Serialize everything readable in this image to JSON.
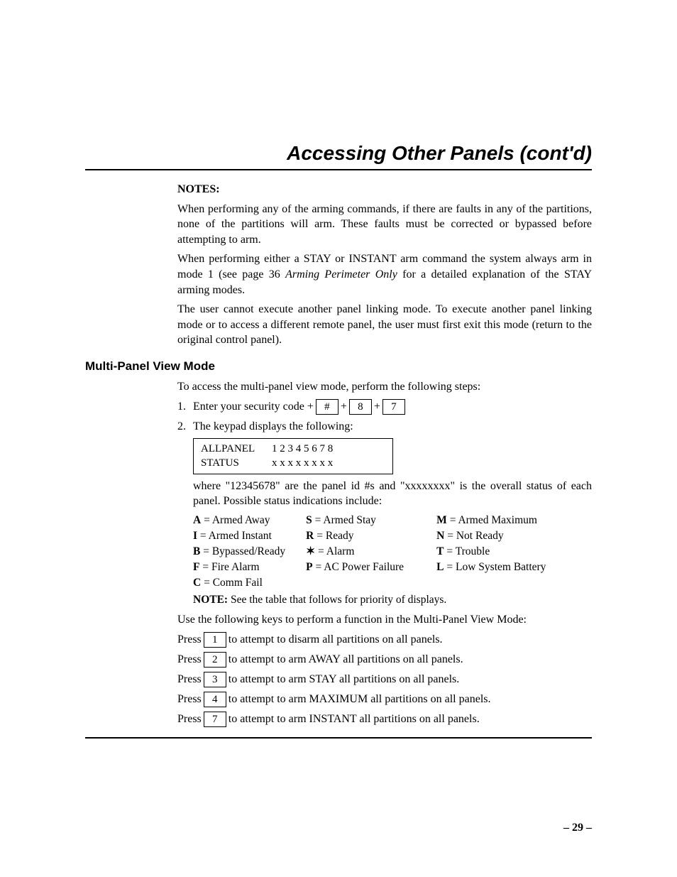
{
  "title": "Accessing Other Panels (cont'd)",
  "notes_label": "NOTES:",
  "para1": "When performing any of the arming commands, if there are faults in any of the partitions, none of the partitions will arm. These faults must be corrected or bypassed before attempting to arm.",
  "para2a": "When performing either a STAY or INSTANT arm command the system always arm in mode 1 (see page 36 ",
  "para2_em": "Arming Perimeter Only",
  "para2b": " for a detailed explanation of the STAY arming modes.",
  "para3": "The user cannot execute another panel linking mode. To execute another panel linking mode or to access a different remote panel, the user must first exit this mode (return to the original control panel).",
  "section_heading": "Multi-Panel View Mode",
  "intro": "To access the multi-panel view mode, perform the following steps:",
  "step1": {
    "num": "1.",
    "text_a": "Enter your security code + ",
    "key1": "#",
    "plus1": " + ",
    "key2": "8",
    "plus2": " + ",
    "key3": "7"
  },
  "step2": {
    "num": "2.",
    "text": "The keypad displays the following:"
  },
  "display": {
    "line1a": "ALLPANEL",
    "line1b": "1 2 3 4 5 6 7 8",
    "line2a": "STATUS",
    "line2b": "x x x x x x x x"
  },
  "where_text": "where \"12345678\" are the panel id #s and \"xxxxxxxx\" is the overall status of each panel. Possible status indications include:",
  "status": {
    "r1": {
      "c1k": "A",
      "c1v": " = Armed Away",
      "c2k": "S",
      "c2v": " = Armed Stay",
      "c3k": "M",
      "c3v": " = Armed Maximum"
    },
    "r2": {
      "c1k": "I",
      "c1v": " = Armed Instant",
      "c2k": "R",
      "c2v": " = Ready",
      "c3k": "N",
      "c3v": " = Not Ready"
    },
    "r3": {
      "c1k": "B",
      "c1v": " = Bypassed/Ready",
      "c2k": "✶",
      "c2v": " = Alarm",
      "c3k": "T",
      "c3v": " = Trouble"
    },
    "r4": {
      "c1k": "F",
      "c1v": " = Fire Alarm",
      "c2k": "P",
      "c2v": " = AC Power Failure",
      "c3k": "L",
      "c3v": " = Low System Battery"
    },
    "r5": {
      "c1k": "C",
      "c1v": " = Comm Fail"
    }
  },
  "note2_label": "NOTE:",
  "note2_text": " See the table that follows for priority of displays.",
  "use_line": "Use the following keys to perform a function in the Multi-Panel View Mode:",
  "press": {
    "p1": {
      "pre": "Press ",
      "key": "1",
      "post": " to attempt to disarm all partitions on all panels."
    },
    "p2": {
      "pre": "Press ",
      "key": "2",
      "post": " to attempt to arm AWAY all partitions on all panels."
    },
    "p3": {
      "pre": "Press ",
      "key": "3",
      "post": " to attempt to arm STAY all partitions on all panels."
    },
    "p4": {
      "pre": "Press ",
      "key": "4",
      "post": " to attempt to arm MAXIMUM all partitions on all panels."
    },
    "p5": {
      "pre": "Press ",
      "key": "7",
      "post": " to attempt to arm INSTANT all partitions on all panels."
    }
  },
  "page_number": "– 29 –"
}
